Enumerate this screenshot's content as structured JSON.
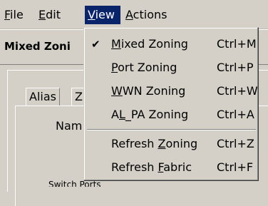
{
  "menubar": {
    "items": [
      {
        "label": "File"
      },
      {
        "label": "Edit"
      },
      {
        "label": "View"
      },
      {
        "label": "Actions"
      }
    ]
  },
  "panel": {
    "title": "Mixed Zoni"
  },
  "tabs": [
    {
      "label": "Alias"
    },
    {
      "label": "Z"
    }
  ],
  "form": {
    "name_label": "Nam"
  },
  "tree": {
    "partial_text": "Switch Ports"
  },
  "view_menu": {
    "items": [
      {
        "label": "Mixed Zoning",
        "accelerator": "Ctrl+M",
        "checked": true
      },
      {
        "label": "Port Zoning",
        "accelerator": "Ctrl+P",
        "checked": false
      },
      {
        "label": "WWN Zoning",
        "accelerator": "Ctrl+W",
        "checked": false
      },
      {
        "label": "AL_PA Zoning",
        "accelerator": "Ctrl+A",
        "checked": false
      },
      {
        "label": "Refresh Zoning",
        "accelerator": "Ctrl+Z",
        "checked": false
      },
      {
        "label": "Refresh Fabric",
        "accelerator": "Ctrl+F",
        "checked": false
      }
    ],
    "check_glyph": "✔"
  },
  "colors": {
    "menu_highlight": "#0a246a",
    "face": "#d4d0c8"
  }
}
